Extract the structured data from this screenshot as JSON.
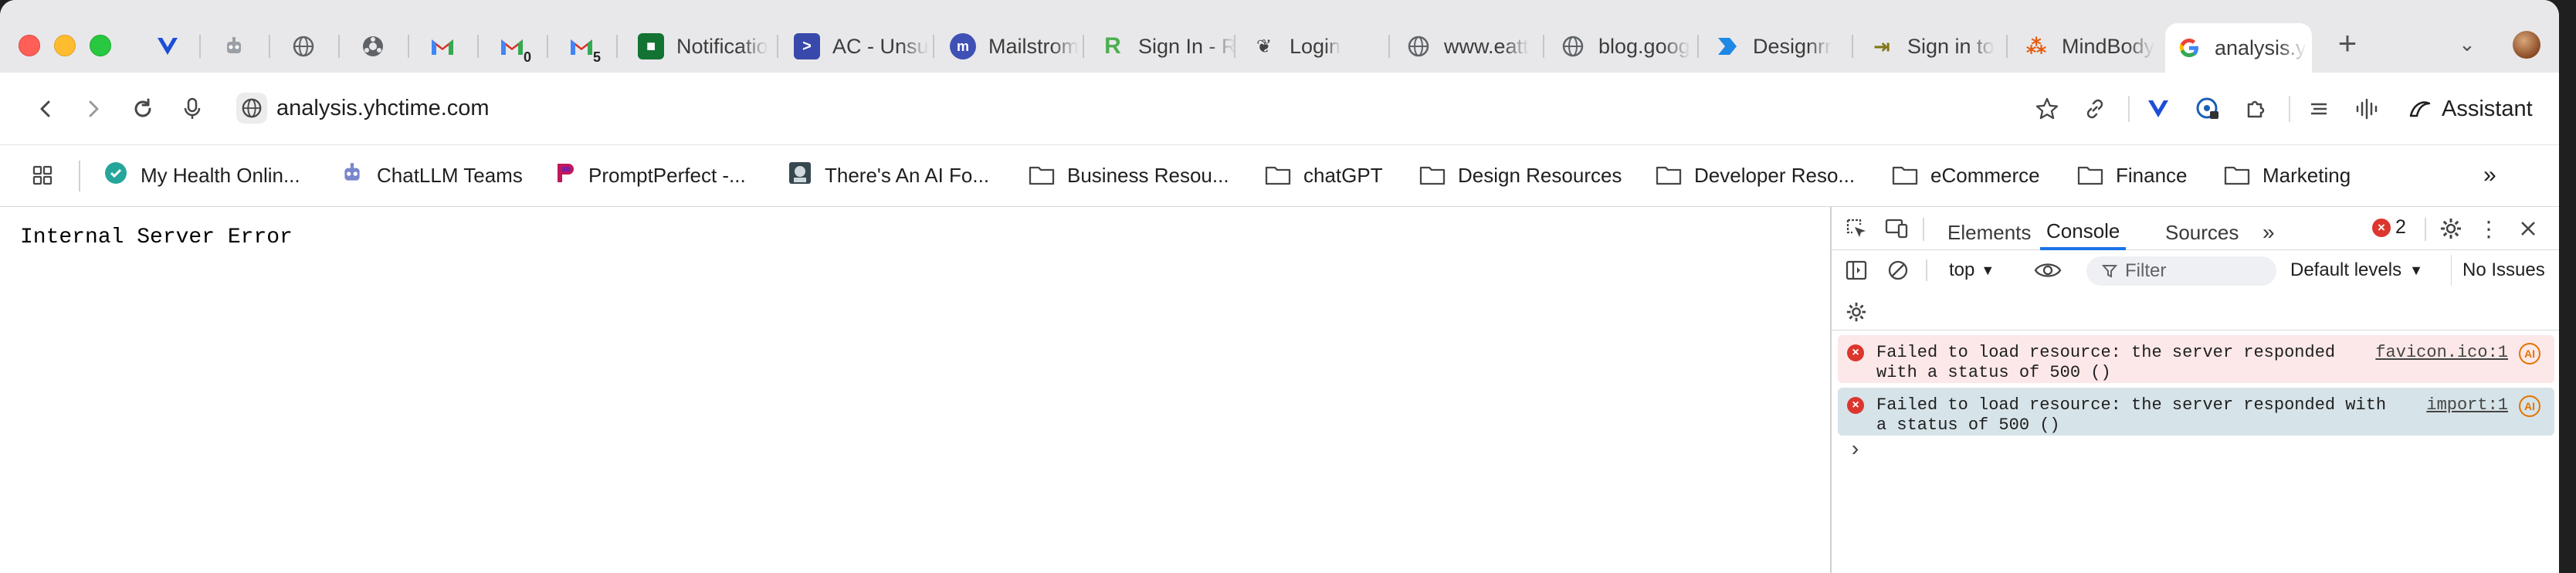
{
  "tabs": [
    {
      "label": "",
      "icon": "vee-icon",
      "color": "#1d4ed8"
    },
    {
      "label": "",
      "icon": "robot-icon",
      "color": "#7a7a7a"
    },
    {
      "label": "",
      "icon": "globe-icon",
      "color": "#5f6368"
    },
    {
      "label": "",
      "icon": "link-icon",
      "color": "#5f6368"
    },
    {
      "label": "",
      "icon": "gmail-icon",
      "color": "#d93025"
    },
    {
      "label": "",
      "badge": "0",
      "icon": "gmail-icon",
      "color": "#d93025"
    },
    {
      "label": "",
      "badge": "5",
      "icon": "gmail-icon",
      "color": "#d93025"
    },
    {
      "label": "Notificatio",
      "icon": "notifications-icon",
      "color": "#137333"
    },
    {
      "label": "AC - Unsu",
      "icon": "ac-icon",
      "color": "#3949ab"
    },
    {
      "label": "Mailstrom",
      "icon": "mailstrom-icon",
      "color": "#3f51b5"
    },
    {
      "label": "Sign In - R",
      "icon": "r-icon",
      "color": "#4caf50"
    },
    {
      "label": "Login",
      "icon": "login-icon",
      "color": "#444444"
    },
    {
      "label": "www.eatt",
      "icon": "globe-icon",
      "color": "#5f6368"
    },
    {
      "label": "blog.goog",
      "icon": "globe-icon",
      "color": "#5f6368"
    },
    {
      "label": "Designrr",
      "icon": "designrr-icon",
      "color": "#1e88e5"
    },
    {
      "label": "Sign in to",
      "icon": "signin-icon",
      "color": "#827717"
    },
    {
      "label": "MindBody",
      "icon": "mindbody-icon",
      "color": "#e8590c"
    },
    {
      "label": "analysis.y",
      "icon": "google-icon",
      "color": "#4285f4",
      "active": true
    }
  ],
  "toolbar": {
    "url": "analysis.yhctime.com",
    "assistant_label": "Assistant"
  },
  "bookmarks": [
    {
      "label": "My Health Onlin...",
      "icon": "health-icon"
    },
    {
      "label": "ChatLLM Teams",
      "icon": "robot-icon"
    },
    {
      "label": "PromptPerfect -...",
      "icon": "promptperfect-icon"
    },
    {
      "label": "There's An AI Fo...",
      "icon": "ai-icon"
    },
    {
      "label": "Business Resou...",
      "icon": "folder-icon"
    },
    {
      "label": "chatGPT",
      "icon": "folder-icon"
    },
    {
      "label": "Design Resources",
      "icon": "folder-icon"
    },
    {
      "label": "Developer Reso...",
      "icon": "folder-icon"
    },
    {
      "label": "eCommerce",
      "icon": "folder-icon"
    },
    {
      "label": "Finance",
      "icon": "folder-icon"
    },
    {
      "label": "Marketing",
      "icon": "folder-icon"
    }
  ],
  "page": {
    "error_text": "Internal Server Error"
  },
  "devtools": {
    "tabs": [
      "Elements",
      "Console",
      "Sources"
    ],
    "active_tab": "Console",
    "error_count": "2",
    "context": "top",
    "filter_placeholder": "Filter",
    "levels": "Default levels",
    "issues": "No Issues",
    "messages": [
      {
        "line1": "Failed to load resource: the server responded",
        "line2": "with a status of 500 ()",
        "source": "favicon.ico:1"
      },
      {
        "line1": "Failed to load resource: the server responded with",
        "line2": "a status of 500 ()",
        "source": "import:1"
      }
    ],
    "prompt": "›"
  },
  "colors": {
    "error_bg": "#fce8e8",
    "selected_msg_bg": "#d6e3e8",
    "accent": "#1a73e8",
    "error_red": "#dc362e"
  }
}
